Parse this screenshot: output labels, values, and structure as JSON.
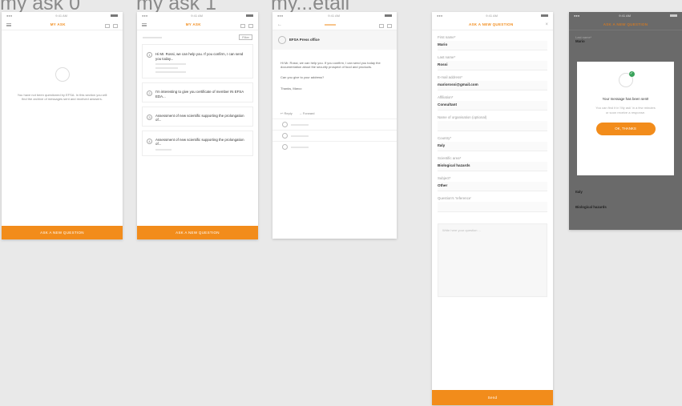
{
  "titles": [
    "my ask 0",
    "my ask 1",
    "my...etail"
  ],
  "screen1": {
    "nav_title": "MY ASK",
    "empty_text": "You have not been questioned by EFSA. In this section you will find the archive of messages sent and received answers.",
    "cta": "ASK A NEW QUESTION"
  },
  "screen2": {
    "nav_title": "MY ASK",
    "filter": "Filter",
    "items": [
      {
        "id": "1",
        "text": "Hi Mr. Rossi, we can help you. If you confirm, I can send you today..."
      },
      {
        "id": "2",
        "text": "I'm interesting to give you certificate of member IN EFSA EDA..."
      },
      {
        "id": "3",
        "text": "Assessment of new scientific supporting the prolongation of..."
      },
      {
        "id": "4",
        "text": "Assessment of new scientific supporting the prolongation of..."
      }
    ],
    "cta": "ASK A NEW QUESTION"
  },
  "screen3": {
    "sender": "EFSA Press office",
    "message": "Hi Mr. Rossi, we can help you. If you confirm, I can send you today the documentation about the security prospect of food and products.",
    "question": "Can you give to your address?",
    "sign": "Thanks, Marco",
    "reply": "Reply",
    "forward": "Forward"
  },
  "screen4": {
    "nav_title": "ASK A NEW QUESTION",
    "fields": [
      {
        "label": "First name*",
        "value": "Mario"
      },
      {
        "label": "Last name*",
        "value": "Rossi"
      },
      {
        "label": "E-mail address*",
        "value": "mariorossi@gmail.com"
      },
      {
        "label": "Affiliation*",
        "value": "Consultant"
      },
      {
        "label": "Name of organisation (optional)",
        "value": ""
      },
      {
        "label": "Country*",
        "value": "Italy"
      },
      {
        "label": "Scientific area*",
        "value": "Biological hazards"
      },
      {
        "label": "Subject*",
        "value": "Other"
      },
      {
        "label": "Question's 'reference'",
        "value": ""
      }
    ],
    "textarea_hint": "Write here your question ...",
    "send": "Send"
  },
  "screen5": {
    "nav_title": "ASK A NEW QUESTION",
    "bg_name_label": "Last name*",
    "bg_name": "Mario",
    "bg_country": "Italy",
    "bg_area": "Biological hazards",
    "dialog_title": "Your message has been sent!",
    "dialog_text": "You can find it in 'My ask' in a few minutes or soon receive a response.",
    "dialog_btn": "OK, THANKS"
  },
  "colors": {
    "accent": "#f28c1b",
    "board": "#e9e9e9"
  }
}
